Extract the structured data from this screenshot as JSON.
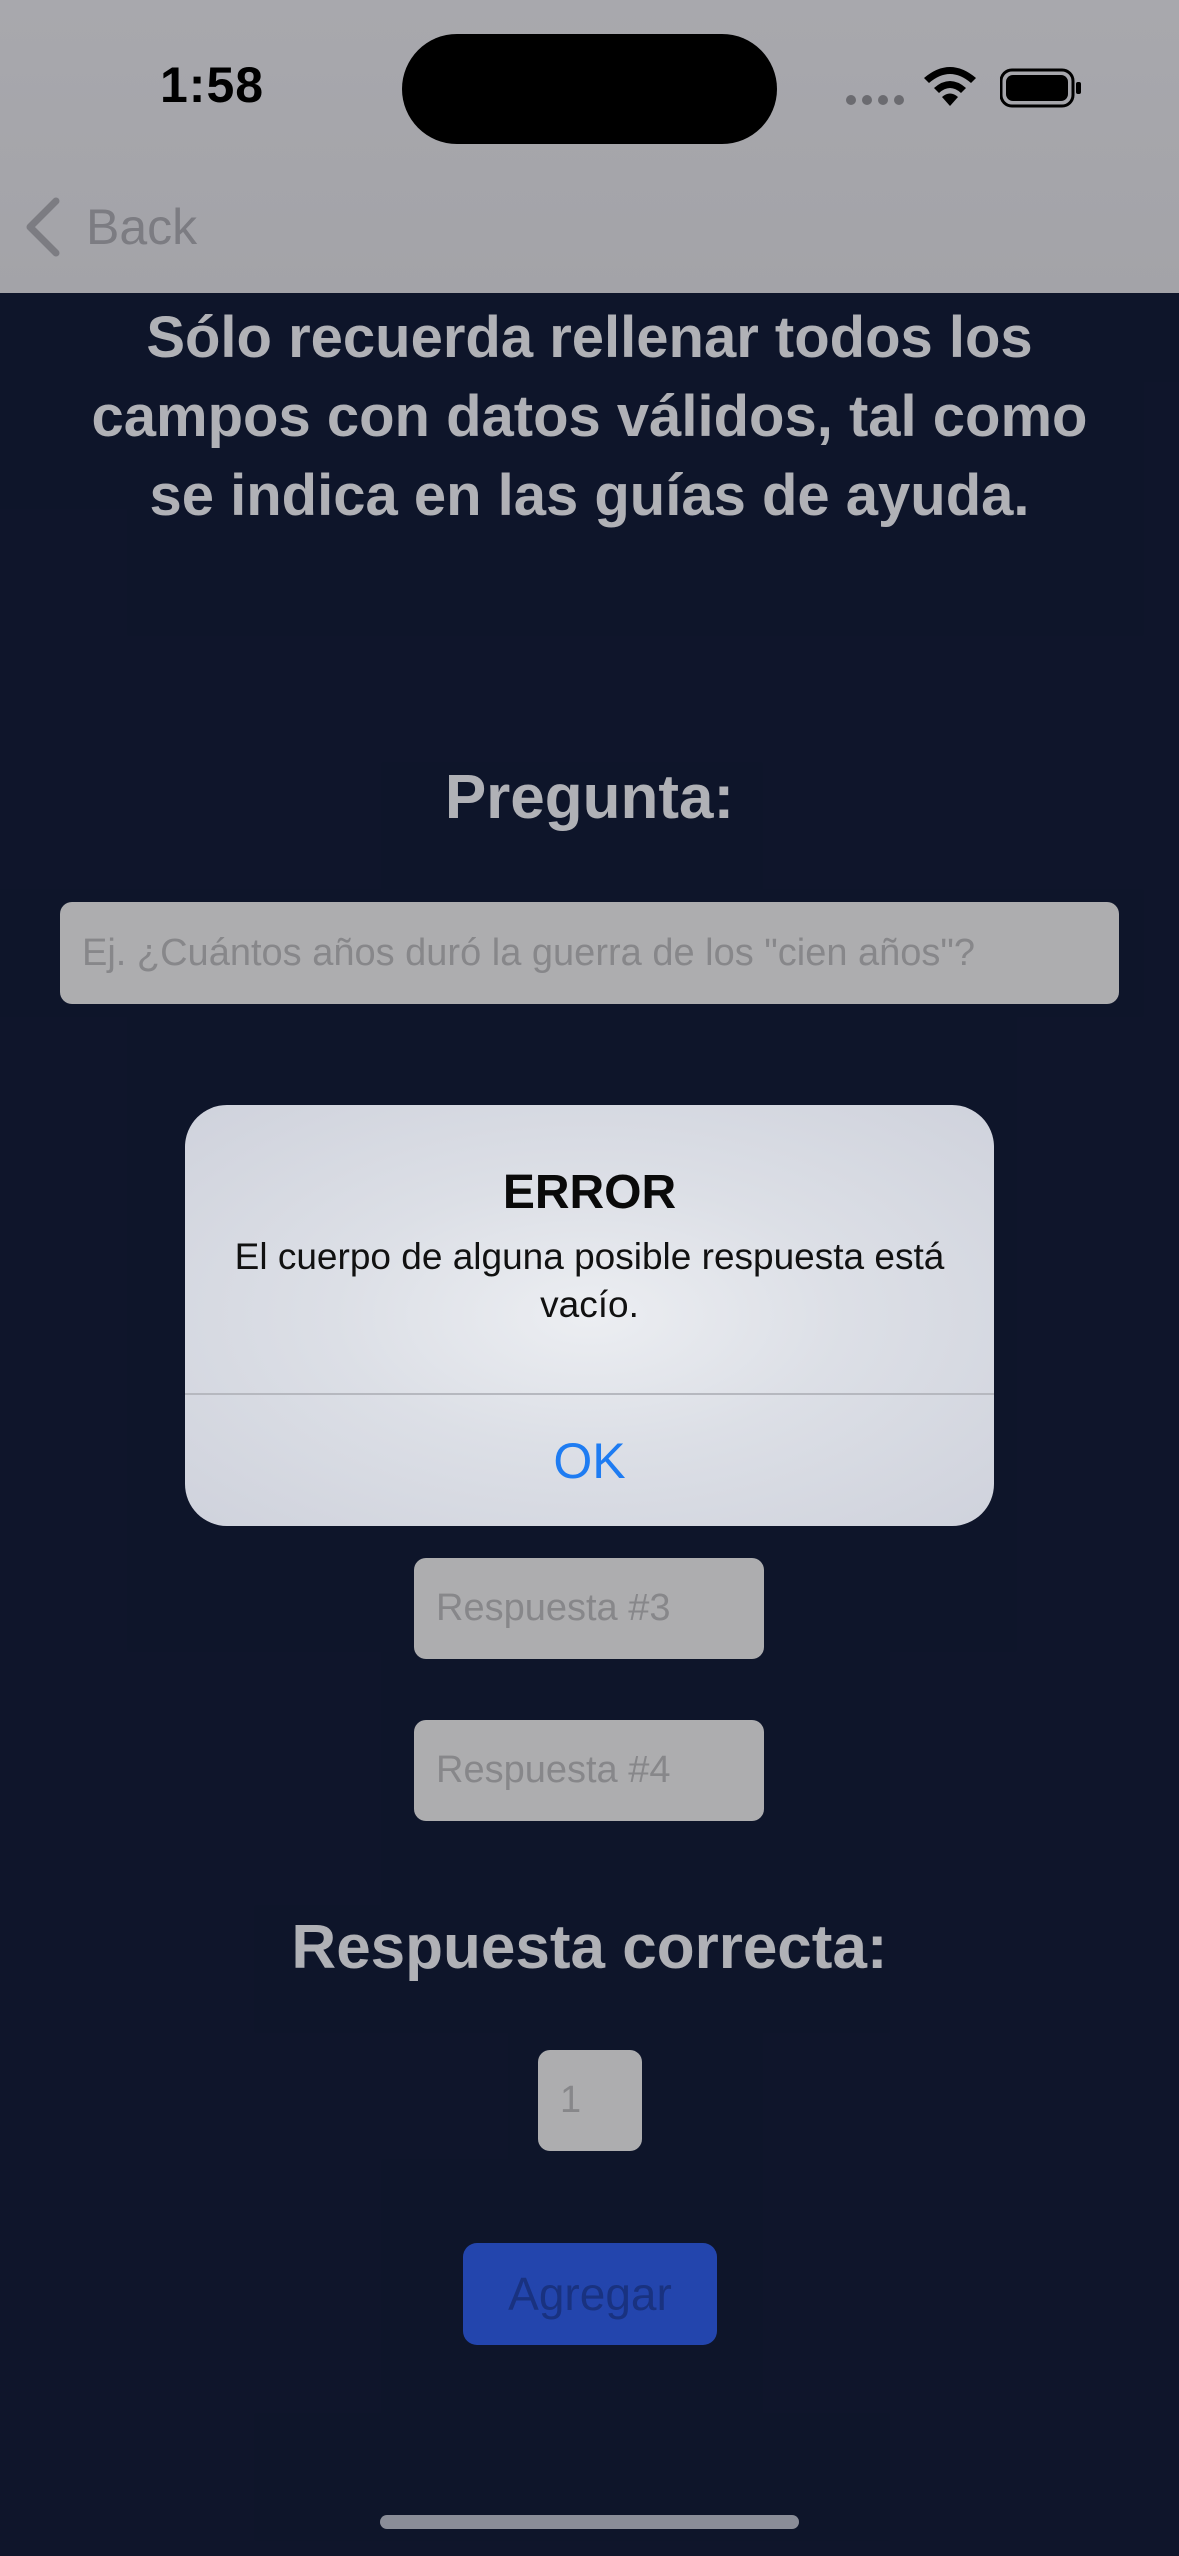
{
  "status_bar": {
    "time": "1:58",
    "icons": [
      "cellular-signal-icon",
      "wifi-icon",
      "battery-icon"
    ]
  },
  "nav": {
    "back_label": "Back"
  },
  "main": {
    "intro": "Sólo recuerda rellenar todos los campos con datos válidos, tal como se indica en las guías de ayuda.",
    "question_heading": "Pregunta:",
    "question_placeholder": "Ej. ¿Cuántos años duró la guerra de los \"cien años\"?",
    "answer3_placeholder": "Respuesta #3",
    "answer4_placeholder": "Respuesta #4",
    "correct_heading": "Respuesta correcta:",
    "correct_value": "1",
    "add_button_label": "Agregar"
  },
  "alert": {
    "title": "ERROR",
    "message": "El cuerpo de alguna posible respuesta está vacío.",
    "ok_label": "OK"
  },
  "colors": {
    "background": "#121a34",
    "accent_blue": "#1e7cf2",
    "add_button": "#2b55d4"
  }
}
